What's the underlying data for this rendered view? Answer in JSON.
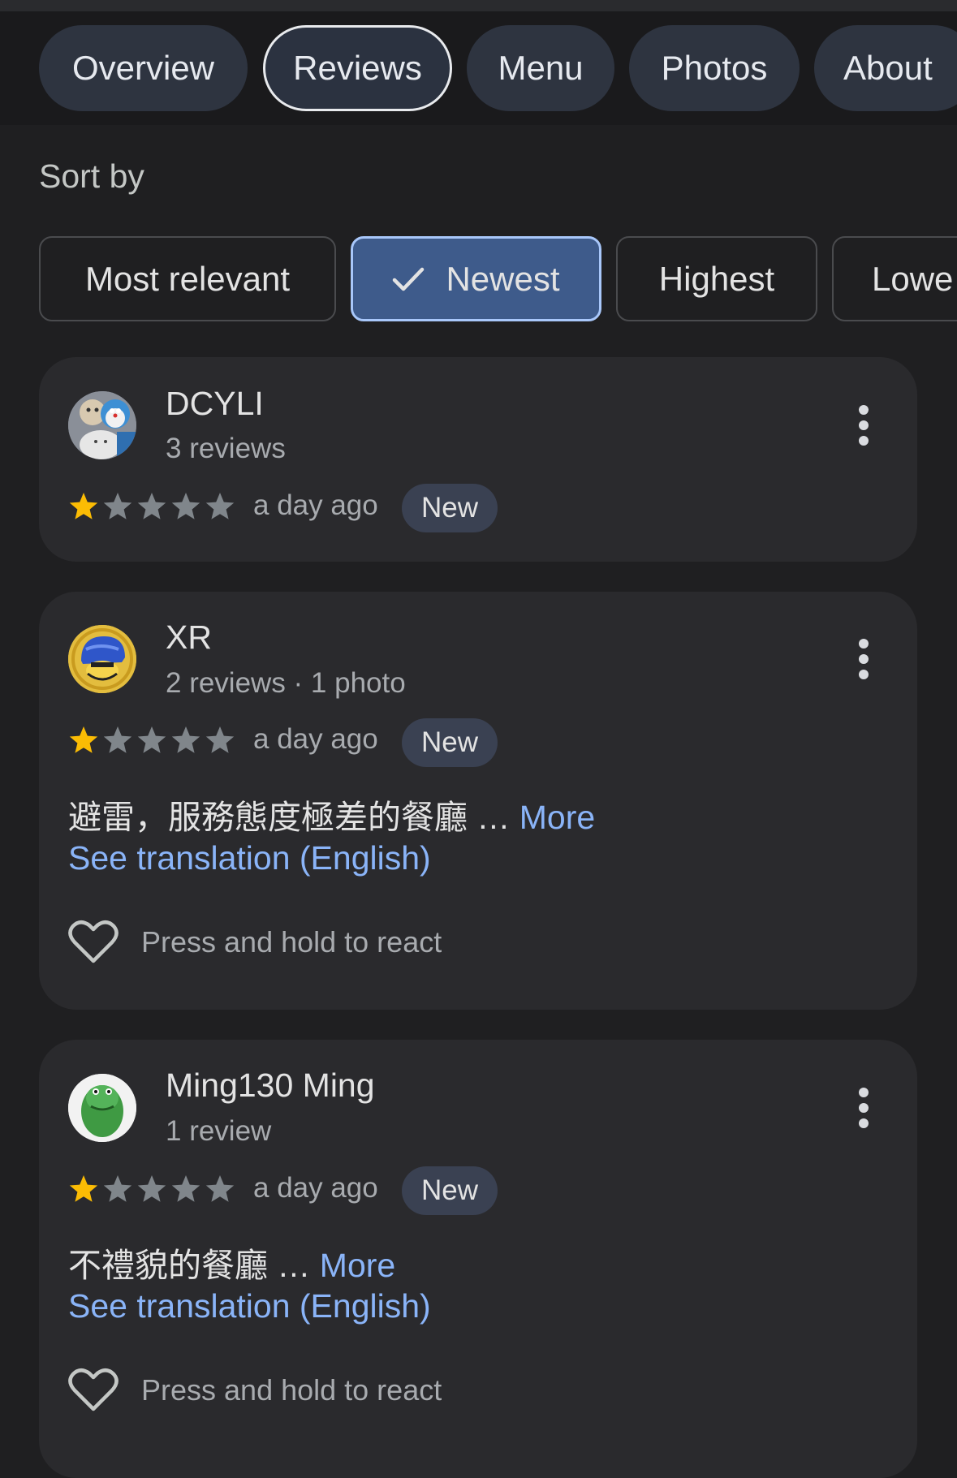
{
  "tabs": [
    {
      "label": "Overview",
      "active": false
    },
    {
      "label": "Reviews",
      "active": true
    },
    {
      "label": "Menu",
      "active": false
    },
    {
      "label": "Photos",
      "active": false
    },
    {
      "label": "About",
      "active": false
    }
  ],
  "sort": {
    "label": "Sort by",
    "options": [
      {
        "label": "Most relevant",
        "selected": false
      },
      {
        "label": "Newest",
        "selected": true
      },
      {
        "label": "Highest",
        "selected": false
      },
      {
        "label": "Lowe",
        "selected": false
      }
    ]
  },
  "reviews": [
    {
      "name": "DCYLI",
      "meta": "3 reviews",
      "rating": 1,
      "max_rating": 5,
      "time": "a day ago",
      "badge": "New",
      "avatar_icon": "doraemon-plush-avatar"
    },
    {
      "name": "XR",
      "meta": "2 reviews · 1 photo",
      "rating": 1,
      "max_rating": 5,
      "time": "a day ago",
      "badge": "New",
      "text": "避雷，服務態度極差的餐廳 … ",
      "more": "More",
      "translation": "See translation (English)",
      "react": "Press and hold to react",
      "avatar_icon": "blue-helmet-avatar"
    },
    {
      "name": "Ming130 Ming",
      "meta": "1 review",
      "rating": 1,
      "max_rating": 5,
      "time": "a day ago",
      "badge": "New",
      "text": "不禮貌的餐廳 … ",
      "more": "More",
      "translation": "See translation (English)",
      "react": "Press and hold to react",
      "avatar_icon": "green-dinosaur-avatar"
    }
  ],
  "colors": {
    "background": "#1f1f21",
    "card": "#2a2a2d",
    "link": "#8ab4f8",
    "star_filled": "#fbbc04",
    "star_empty": "#80868b",
    "selected_chip": "#3e5b8b"
  }
}
